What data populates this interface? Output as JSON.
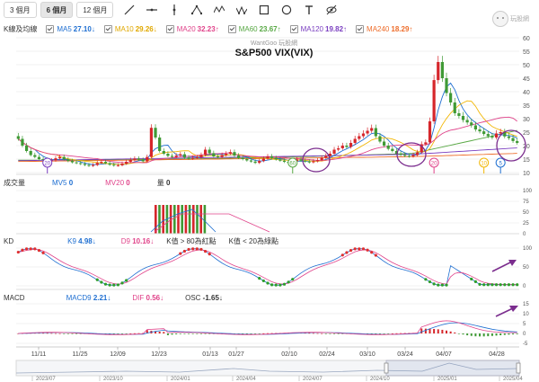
{
  "toolbar": {
    "ranges": [
      "3 個月",
      "6 個月",
      "12 個月"
    ],
    "active_range": "6 個月",
    "tools": [
      "line-tool-icon",
      "horizontal-line-icon",
      "vertical-line-icon",
      "triangle-pattern-icon",
      "wave-pattern-icon",
      "zigzag-icon",
      "rectangle-icon",
      "circle-icon",
      "text-icon",
      "visibility-off-icon"
    ]
  },
  "logo": {
    "text": "玩股網"
  },
  "ma_legend": {
    "label": "K線及均線",
    "items": [
      {
        "name": "MA5",
        "value": "27.10",
        "arrow": "↓",
        "color": "#1f6fd1"
      },
      {
        "name": "MA10",
        "value": "29.26",
        "arrow": "↓",
        "color": "#f2b705"
      },
      {
        "name": "MA20",
        "value": "32.23",
        "arrow": "↑",
        "color": "#e0438a"
      },
      {
        "name": "MA60",
        "value": "23.67",
        "arrow": "↑",
        "color": "#58a844"
      },
      {
        "name": "MA120",
        "value": "19.82",
        "arrow": "↑",
        "color": "#7b3fc0"
      },
      {
        "name": "MA240",
        "value": "18.29",
        "arrow": "↑",
        "color": "#ee6d2b"
      }
    ]
  },
  "volume_legend": {
    "label": "成交量",
    "mv5": {
      "name": "MV5",
      "value": "0",
      "color": "#1f6fd1"
    },
    "mv20": {
      "name": "MV20",
      "value": "0",
      "color": "#e0438a"
    },
    "qty": {
      "name": "量",
      "value": "0"
    }
  },
  "kd_legend": {
    "label": "KD",
    "k9": {
      "name": "K9",
      "value": "4.98",
      "arrow": "↓",
      "color": "#1f6fd1"
    },
    "d9": {
      "name": "D9",
      "value": "10.16",
      "arrow": "↓",
      "color": "#e0438a"
    },
    "note_high": "K值 > 80為紅點",
    "note_low": "K值 < 20為綠點"
  },
  "macd_legend": {
    "label": "MACD",
    "macd9": {
      "name": "MACD9",
      "value": "2.21",
      "arrow": "↓",
      "color": "#1f6fd1"
    },
    "dif": {
      "name": "DIF",
      "value": "0.56",
      "arrow": "↓",
      "color": "#e0438a"
    },
    "osc": {
      "name": "OSC",
      "value": "-1.65",
      "arrow": "↓"
    }
  },
  "colors": {
    "up": "#d6262b",
    "down": "#3f9a35",
    "kd_low_dot": "#2e9e2a",
    "kd_high_dot": "#e03030",
    "highlight": "#7b2d8e"
  },
  "chart_data": {
    "type": "line",
    "watermark": "WantGoo 玩股網",
    "title": "S&P500 VIX(VIX)",
    "price_axis": {
      "ticks": [
        10,
        15,
        20,
        25,
        30,
        35,
        40,
        45,
        50,
        55,
        60
      ],
      "ylim": [
        10,
        60
      ]
    },
    "volume_axis": {
      "ticks": [
        0,
        25,
        50,
        75,
        100
      ]
    },
    "kd_axis": {
      "ticks": [
        0,
        50,
        100
      ],
      "ylim": [
        0,
        100
      ]
    },
    "macd_axis": {
      "ticks": [
        -5,
        0,
        5,
        10,
        15
      ]
    },
    "date_ticks": [
      "11/11",
      "11/25",
      "12/09",
      "12/23",
      "01/13",
      "01/27",
      "02/10",
      "02/24",
      "03/10",
      "03/24",
      "04/07",
      "04/28"
    ],
    "navigator_ticks": [
      "2023/07",
      "2023/10",
      "2024/01",
      "2024/04",
      "2024/07",
      "2024/10",
      "2025/01",
      "2025/04"
    ],
    "event_markers": [
      {
        "label": "20",
        "color": "#7b3fc0",
        "date": "11/19"
      },
      {
        "label": "60",
        "color": "#58a844",
        "date": "02/07"
      },
      {
        "label": "20",
        "color": "#e0438a",
        "date": "04/01"
      },
      {
        "label": "10",
        "color": "#f2b705",
        "date": "04/22"
      },
      {
        "label": "5",
        "color": "#1f6fd1",
        "date": "04/25"
      }
    ],
    "close_approx": [
      23.5,
      21.0,
      19.0,
      17.5,
      16.8,
      16.0,
      15.8,
      15.2,
      15.5,
      16.3,
      16.8,
      15.9,
      15.3,
      14.8,
      14.5,
      14.2,
      13.8,
      13.5,
      13.8,
      14.6,
      15.0,
      14.5,
      13.9,
      13.6,
      13.7,
      14.3,
      15.0,
      15.7,
      16.2,
      15.8,
      15.2,
      16.8,
      27.6,
      24.0,
      19.0,
      18.0,
      17.2,
      16.8,
      17.3,
      17.8,
      16.6,
      16.2,
      16.5,
      16.7,
      17.5,
      19.5,
      18.2,
      17.0,
      16.8,
      17.5,
      18.0,
      18.6,
      17.3,
      16.5,
      16.0,
      15.5,
      15.1,
      14.6,
      15.3,
      16.2,
      17.0,
      16.4,
      15.9,
      15.4,
      15.0,
      14.6,
      15.2,
      15.9,
      15.4,
      15.1,
      14.8,
      15.2,
      15.6,
      16.5,
      17.2,
      18.0,
      19.5,
      20.0,
      21.0,
      20.5,
      22.0,
      23.5,
      24.5,
      25.5,
      26.5,
      27.5,
      24.5,
      22.5,
      21.0,
      19.8,
      19.0,
      18.0,
      17.6,
      17.2,
      17.0,
      17.5,
      18.5,
      21.5,
      22.2,
      30.0,
      45.3,
      52.0,
      46.0,
      40.5,
      37.0,
      33.0,
      32.0,
      30.5,
      29.6,
      28.5,
      27.0,
      26.3,
      25.3,
      24.5,
      24.0,
      25.5,
      26.0,
      24.4,
      23.8,
      22.7,
      22.0
    ],
    "series": [
      {
        "name": "MA5",
        "color": "#1f6fd1"
      },
      {
        "name": "MA10",
        "color": "#f2b705"
      },
      {
        "name": "MA20",
        "color": "#e0438a"
      },
      {
        "name": "MA60",
        "color": "#58a844"
      },
      {
        "name": "MA120",
        "color": "#7b3fc0"
      },
      {
        "name": "MA240",
        "color": "#ee6d2b"
      }
    ]
  }
}
